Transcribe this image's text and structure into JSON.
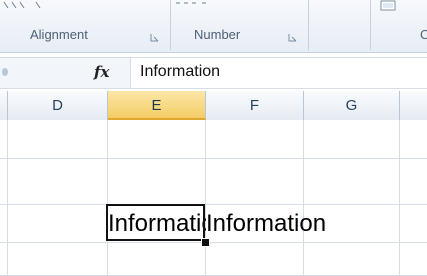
{
  "ribbon": {
    "groups": [
      {
        "label": "Alignment"
      },
      {
        "label": "Number"
      },
      {
        "label": "C"
      }
    ]
  },
  "formula_bar": {
    "fx_label": "fx",
    "value": "Information"
  },
  "columns": [
    "D",
    "E",
    "F",
    "G"
  ],
  "active_column": "E",
  "cells": {
    "E_row": "Information",
    "F_row": "Information"
  },
  "colors": {
    "active_header": "#f5cd66",
    "grid_line": "#d6dde7",
    "ribbon_text": "#4d5f75"
  }
}
